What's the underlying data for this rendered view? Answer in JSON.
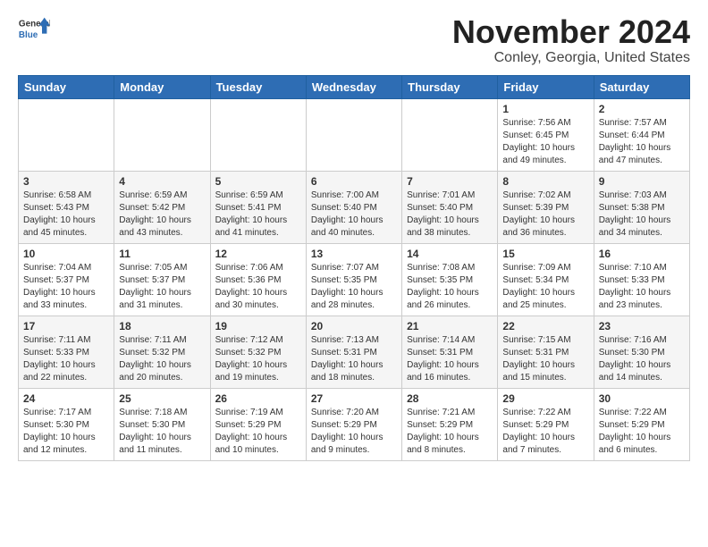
{
  "header": {
    "logo_general": "General",
    "logo_blue": "Blue",
    "title": "November 2024",
    "subtitle": "Conley, Georgia, United States"
  },
  "weekdays": [
    "Sunday",
    "Monday",
    "Tuesday",
    "Wednesday",
    "Thursday",
    "Friday",
    "Saturday"
  ],
  "weeks": [
    [
      {
        "day": "",
        "info": ""
      },
      {
        "day": "",
        "info": ""
      },
      {
        "day": "",
        "info": ""
      },
      {
        "day": "",
        "info": ""
      },
      {
        "day": "",
        "info": ""
      },
      {
        "day": "1",
        "info": "Sunrise: 7:56 AM\nSunset: 6:45 PM\nDaylight: 10 hours\nand 49 minutes."
      },
      {
        "day": "2",
        "info": "Sunrise: 7:57 AM\nSunset: 6:44 PM\nDaylight: 10 hours\nand 47 minutes."
      }
    ],
    [
      {
        "day": "3",
        "info": "Sunrise: 6:58 AM\nSunset: 5:43 PM\nDaylight: 10 hours\nand 45 minutes."
      },
      {
        "day": "4",
        "info": "Sunrise: 6:59 AM\nSunset: 5:42 PM\nDaylight: 10 hours\nand 43 minutes."
      },
      {
        "day": "5",
        "info": "Sunrise: 6:59 AM\nSunset: 5:41 PM\nDaylight: 10 hours\nand 41 minutes."
      },
      {
        "day": "6",
        "info": "Sunrise: 7:00 AM\nSunset: 5:40 PM\nDaylight: 10 hours\nand 40 minutes."
      },
      {
        "day": "7",
        "info": "Sunrise: 7:01 AM\nSunset: 5:40 PM\nDaylight: 10 hours\nand 38 minutes."
      },
      {
        "day": "8",
        "info": "Sunrise: 7:02 AM\nSunset: 5:39 PM\nDaylight: 10 hours\nand 36 minutes."
      },
      {
        "day": "9",
        "info": "Sunrise: 7:03 AM\nSunset: 5:38 PM\nDaylight: 10 hours\nand 34 minutes."
      }
    ],
    [
      {
        "day": "10",
        "info": "Sunrise: 7:04 AM\nSunset: 5:37 PM\nDaylight: 10 hours\nand 33 minutes."
      },
      {
        "day": "11",
        "info": "Sunrise: 7:05 AM\nSunset: 5:37 PM\nDaylight: 10 hours\nand 31 minutes."
      },
      {
        "day": "12",
        "info": "Sunrise: 7:06 AM\nSunset: 5:36 PM\nDaylight: 10 hours\nand 30 minutes."
      },
      {
        "day": "13",
        "info": "Sunrise: 7:07 AM\nSunset: 5:35 PM\nDaylight: 10 hours\nand 28 minutes."
      },
      {
        "day": "14",
        "info": "Sunrise: 7:08 AM\nSunset: 5:35 PM\nDaylight: 10 hours\nand 26 minutes."
      },
      {
        "day": "15",
        "info": "Sunrise: 7:09 AM\nSunset: 5:34 PM\nDaylight: 10 hours\nand 25 minutes."
      },
      {
        "day": "16",
        "info": "Sunrise: 7:10 AM\nSunset: 5:33 PM\nDaylight: 10 hours\nand 23 minutes."
      }
    ],
    [
      {
        "day": "17",
        "info": "Sunrise: 7:11 AM\nSunset: 5:33 PM\nDaylight: 10 hours\nand 22 minutes."
      },
      {
        "day": "18",
        "info": "Sunrise: 7:11 AM\nSunset: 5:32 PM\nDaylight: 10 hours\nand 20 minutes."
      },
      {
        "day": "19",
        "info": "Sunrise: 7:12 AM\nSunset: 5:32 PM\nDaylight: 10 hours\nand 19 minutes."
      },
      {
        "day": "20",
        "info": "Sunrise: 7:13 AM\nSunset: 5:31 PM\nDaylight: 10 hours\nand 18 minutes."
      },
      {
        "day": "21",
        "info": "Sunrise: 7:14 AM\nSunset: 5:31 PM\nDaylight: 10 hours\nand 16 minutes."
      },
      {
        "day": "22",
        "info": "Sunrise: 7:15 AM\nSunset: 5:31 PM\nDaylight: 10 hours\nand 15 minutes."
      },
      {
        "day": "23",
        "info": "Sunrise: 7:16 AM\nSunset: 5:30 PM\nDaylight: 10 hours\nand 14 minutes."
      }
    ],
    [
      {
        "day": "24",
        "info": "Sunrise: 7:17 AM\nSunset: 5:30 PM\nDaylight: 10 hours\nand 12 minutes."
      },
      {
        "day": "25",
        "info": "Sunrise: 7:18 AM\nSunset: 5:30 PM\nDaylight: 10 hours\nand 11 minutes."
      },
      {
        "day": "26",
        "info": "Sunrise: 7:19 AM\nSunset: 5:29 PM\nDaylight: 10 hours\nand 10 minutes."
      },
      {
        "day": "27",
        "info": "Sunrise: 7:20 AM\nSunset: 5:29 PM\nDaylight: 10 hours\nand 9 minutes."
      },
      {
        "day": "28",
        "info": "Sunrise: 7:21 AM\nSunset: 5:29 PM\nDaylight: 10 hours\nand 8 minutes."
      },
      {
        "day": "29",
        "info": "Sunrise: 7:22 AM\nSunset: 5:29 PM\nDaylight: 10 hours\nand 7 minutes."
      },
      {
        "day": "30",
        "info": "Sunrise: 7:22 AM\nSunset: 5:29 PM\nDaylight: 10 hours\nand 6 minutes."
      }
    ]
  ]
}
